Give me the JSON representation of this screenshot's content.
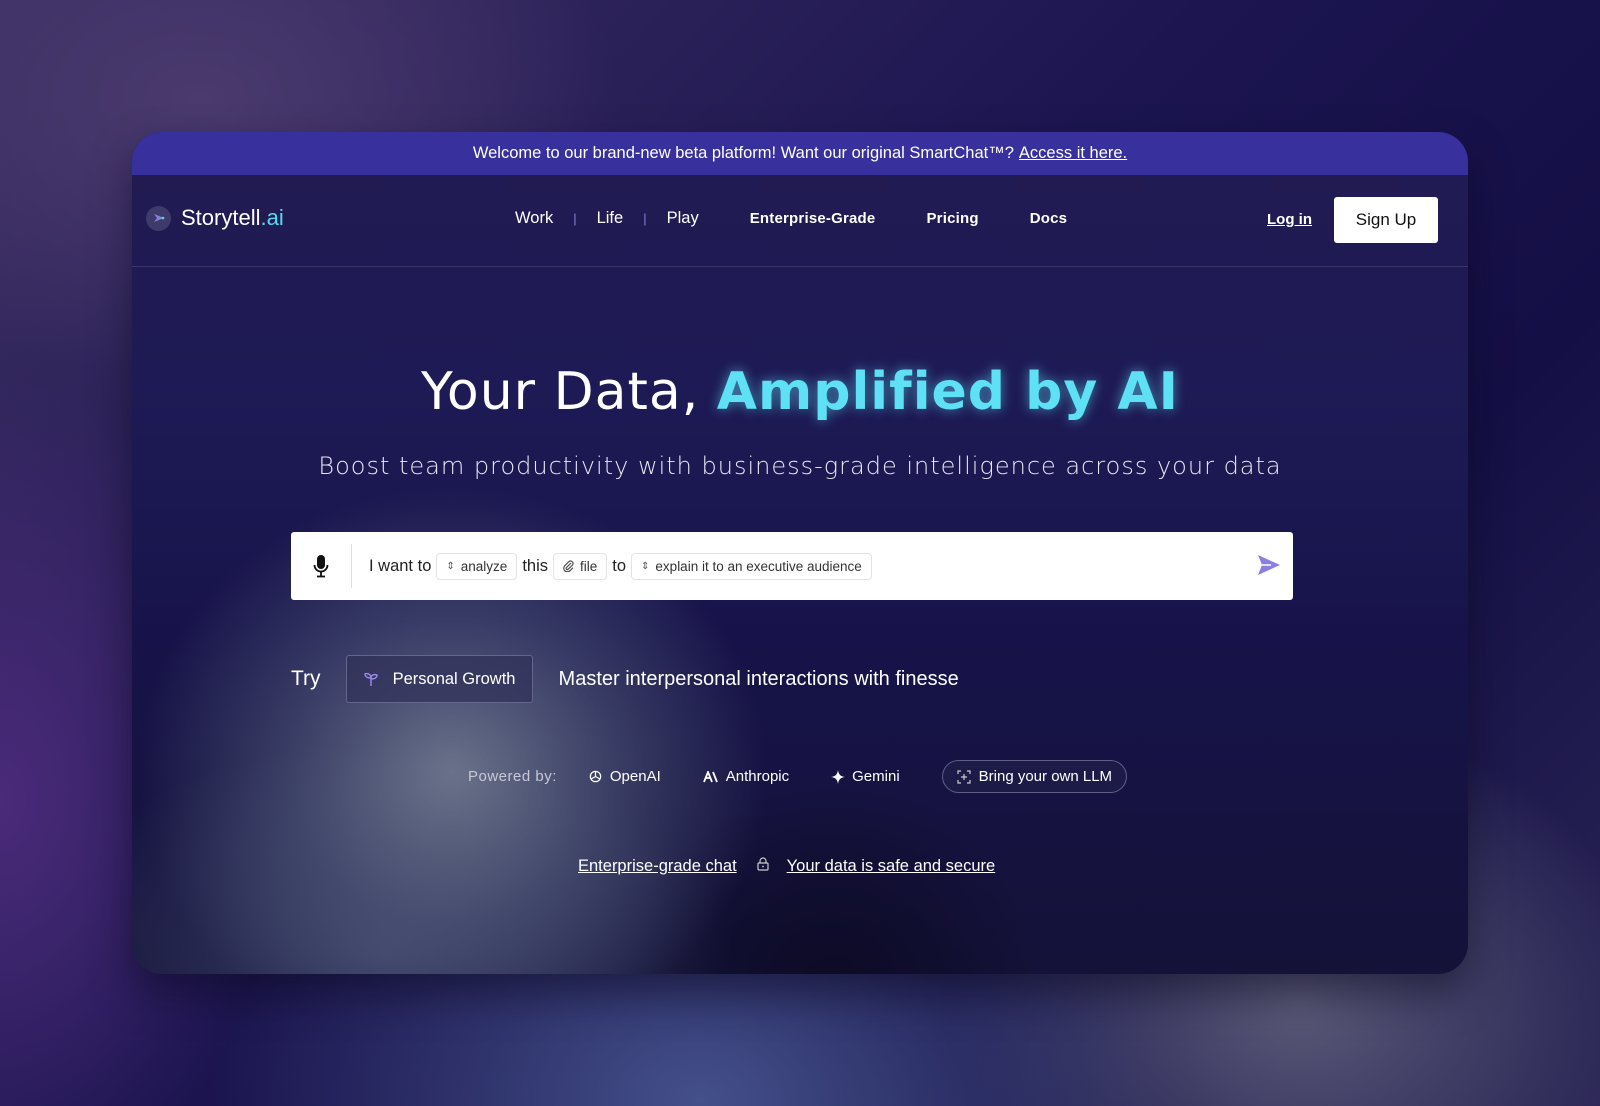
{
  "banner": {
    "text": "Welcome to our brand-new beta platform! Want our original SmartChat™?",
    "link": "Access it here."
  },
  "nav": {
    "logo_main": "Storytell",
    "logo_suffix": ".ai",
    "links": [
      "Work",
      "Life",
      "Play",
      "Enterprise-Grade",
      "Pricing",
      "Docs"
    ],
    "login": "Log in",
    "signup": "Sign Up"
  },
  "hero": {
    "title_plain": "Your Data, ",
    "title_accent": "Amplified by AI",
    "subtitle": "Boost team productivity with business-grade intelligence across your data",
    "accent_color": "#5ee0f5"
  },
  "prompt": {
    "part1": "I want to",
    "verb": "analyze",
    "part2": "this",
    "object": "file",
    "part3": "to",
    "goal": "explain it to an executive audience",
    "icons": [
      "microphone-icon",
      "paperclip-icon",
      "send-icon"
    ],
    "send_color": "#8b7fe0"
  },
  "try": {
    "label": "Try",
    "category": "Personal Growth",
    "description": "Master interpersonal interactions with finesse"
  },
  "powered": {
    "label": "Powered by:",
    "providers": [
      "OpenAI",
      "Anthropic",
      "Gemini"
    ],
    "byo": "Bring your own LLM"
  },
  "footer": {
    "link1": "Enterprise-grade chat",
    "link2": "Your data is safe and secure"
  }
}
